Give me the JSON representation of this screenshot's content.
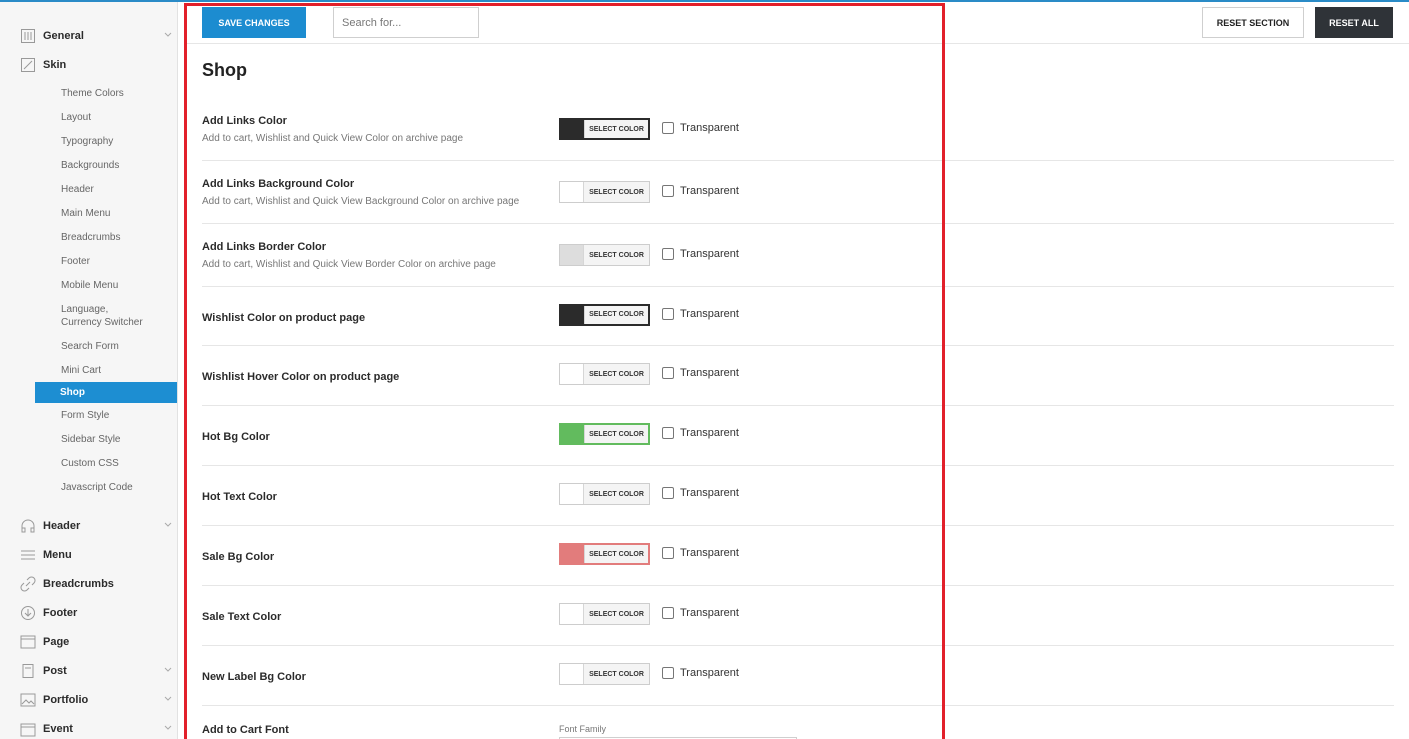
{
  "toolbar": {
    "save_label": "SAVE CHANGES",
    "search_placeholder": "Search for...",
    "reset_section_label": "RESET SECTION",
    "reset_all_label": "RESET ALL"
  },
  "sidebar": {
    "top_items": [
      {
        "label": "General",
        "icon": "general-icon",
        "has_chevron": true
      },
      {
        "label": "Skin",
        "icon": "skin-icon",
        "has_chevron": false
      }
    ],
    "skin_subitems": [
      "Theme Colors",
      "Layout",
      "Typography",
      "Backgrounds",
      "Header",
      "Main Menu",
      "Breadcrumbs",
      "Footer",
      "Mobile Menu",
      "Language, Currency Switcher",
      "Search Form",
      "Mini Cart",
      "Shop",
      "Form Style",
      "Sidebar Style",
      "Custom CSS",
      "Javascript Code"
    ],
    "active_subitem": "Shop",
    "bottom_items": [
      {
        "label": "Header",
        "icon": "headphones-icon",
        "has_chevron": true
      },
      {
        "label": "Menu",
        "icon": "menu-icon",
        "has_chevron": false
      },
      {
        "label": "Breadcrumbs",
        "icon": "link-icon",
        "has_chevron": false
      },
      {
        "label": "Footer",
        "icon": "download-circle-icon",
        "has_chevron": false
      },
      {
        "label": "Page",
        "icon": "page-icon",
        "has_chevron": false
      },
      {
        "label": "Post",
        "icon": "post-icon",
        "has_chevron": true
      },
      {
        "label": "Portfolio",
        "icon": "image-icon",
        "has_chevron": true
      },
      {
        "label": "Event",
        "icon": "calendar-icon",
        "has_chevron": true
      }
    ]
  },
  "main": {
    "title": "Shop",
    "select_color_label": "SELECT COLOR",
    "transparent_label": "Transparent",
    "settings": [
      {
        "title": "Add Links Color",
        "desc": "Add to cart, Wishlist and Quick View Color on archive page",
        "color": "#2b2b2b"
      },
      {
        "title": "Add Links Background Color",
        "desc": "Add to cart, Wishlist and Quick View Background Color on archive page",
        "color": "#ffffff"
      },
      {
        "title": "Add Links Border Color",
        "desc": "Add to cart, Wishlist and Quick View Border Color on archive page",
        "color": "#dddddd"
      },
      {
        "title": "Wishlist Color on product page",
        "desc": "",
        "color": "#2b2b2b"
      },
      {
        "title": "Wishlist Hover Color on product page",
        "desc": "",
        "color": "#ffffff"
      },
      {
        "title": "Hot Bg Color",
        "desc": "",
        "color": "#62bb5e"
      },
      {
        "title": "Hot Text Color",
        "desc": "",
        "color": "#ffffff"
      },
      {
        "title": "Sale Bg Color",
        "desc": "",
        "color": "#e27c7c"
      },
      {
        "title": "Sale Text Color",
        "desc": "",
        "color": "#ffffff"
      },
      {
        "title": "New Label Bg Color",
        "desc": "",
        "color": "#ffffff"
      }
    ],
    "font_setting": {
      "title": "Add to Cart Font",
      "font_family_label": "Font Family"
    }
  },
  "colors": {
    "accent": "#1c8cd0",
    "dark_button": "#2f3338",
    "highlight_border": "#e2202a"
  }
}
